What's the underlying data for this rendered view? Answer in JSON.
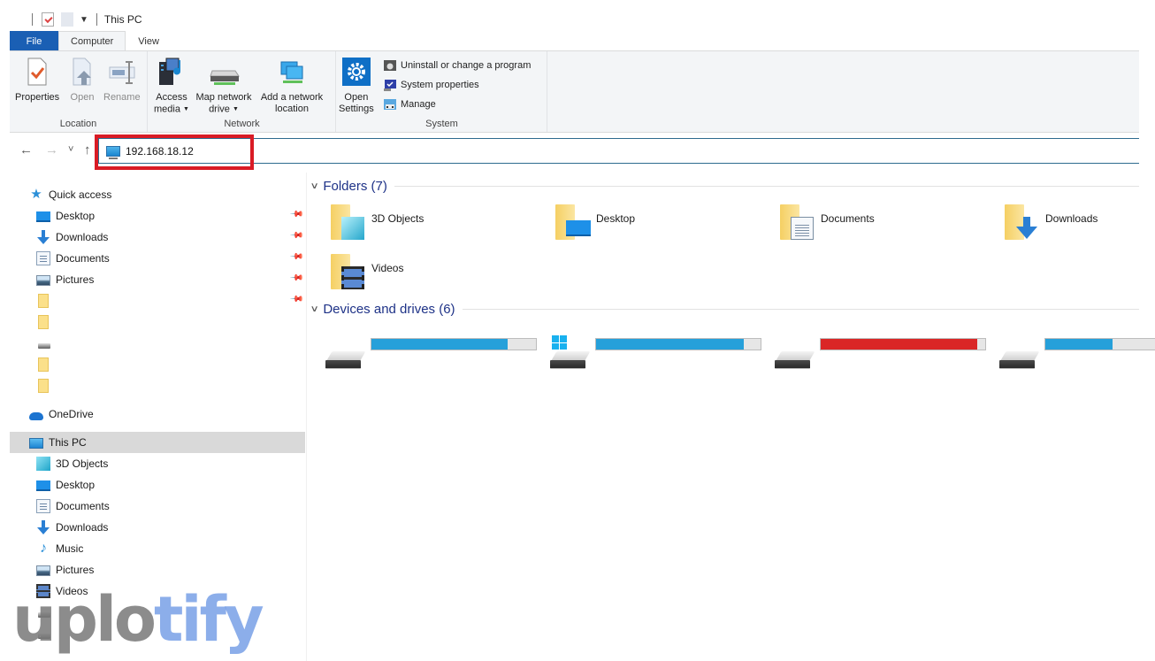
{
  "window": {
    "title": "This PC"
  },
  "quick_access_toolbar": {
    "icons": [
      "properties-icon",
      "new-folder-icon",
      "customize-dropdown-icon"
    ]
  },
  "tabs": [
    {
      "label": "File",
      "active": false
    },
    {
      "label": "Computer",
      "active": true
    },
    {
      "label": "View",
      "active": false
    }
  ],
  "ribbon": {
    "groups": [
      {
        "label": "Location",
        "buttons": [
          {
            "label": "Properties",
            "icon": "properties-icon",
            "enabled": true
          },
          {
            "label": "Open",
            "icon": "open-icon",
            "enabled": false
          },
          {
            "label": "Rename",
            "icon": "rename-icon",
            "enabled": false
          }
        ]
      },
      {
        "label": "Network",
        "buttons": [
          {
            "label_line1": "Access",
            "label_line2": "media",
            "icon": "access-media-icon",
            "dropdown": true
          },
          {
            "label_line1": "Map network",
            "label_line2": "drive",
            "icon": "map-network-drive-icon",
            "dropdown": true
          },
          {
            "label_line1": "Add a network",
            "label_line2": "location",
            "icon": "add-network-location-icon"
          }
        ]
      },
      {
        "label": "System",
        "buttons": [
          {
            "label_line1": "Open",
            "label_line2": "Settings",
            "icon": "settings-gear-icon"
          }
        ],
        "small_buttons": [
          {
            "label": "Uninstall or change a program",
            "icon": "uninstall-program-icon"
          },
          {
            "label": "System properties",
            "icon": "system-properties-icon"
          },
          {
            "label": "Manage",
            "icon": "manage-icon"
          }
        ]
      }
    ]
  },
  "navigation": {
    "back": "←",
    "forward": "→",
    "recent": "˅",
    "up": "↑"
  },
  "address_bar": {
    "value": "192.168.18.12",
    "icon": "this-pc-icon",
    "highlighted": true,
    "highlight_color": "#d91b25"
  },
  "sidebar": {
    "quick_access": {
      "label": "Quick access",
      "items": [
        {
          "label": "Desktop",
          "icon": "desktop-icon",
          "pinned": true
        },
        {
          "label": "Downloads",
          "icon": "downloads-icon",
          "pinned": true
        },
        {
          "label": "Documents",
          "icon": "documents-icon",
          "pinned": true
        },
        {
          "label": "Pictures",
          "icon": "pictures-icon",
          "pinned": true
        },
        {
          "label": "",
          "icon": "folder-icon",
          "pinned": true
        },
        {
          "label": "",
          "icon": "folder-icon",
          "pinned": false
        },
        {
          "label": "",
          "icon": "drive-icon",
          "pinned": false
        },
        {
          "label": "",
          "icon": "folder-icon",
          "pinned": false
        },
        {
          "label": "",
          "icon": "folder-icon",
          "pinned": false
        }
      ]
    },
    "onedrive": {
      "label": "OneDrive"
    },
    "this_pc": {
      "label": "This PC",
      "selected": true,
      "items": [
        {
          "label": "3D Objects",
          "icon": "3d-objects-icon"
        },
        {
          "label": "Desktop",
          "icon": "desktop-icon"
        },
        {
          "label": "Documents",
          "icon": "documents-icon"
        },
        {
          "label": "Downloads",
          "icon": "downloads-icon"
        },
        {
          "label": "Music",
          "icon": "music-icon"
        },
        {
          "label": "Pictures",
          "icon": "pictures-icon"
        },
        {
          "label": "Videos",
          "icon": "videos-icon"
        }
      ]
    },
    "pin_glyph": "📌"
  },
  "content": {
    "folders_section": {
      "label": "Folders (7)",
      "items": [
        {
          "label": "3D Objects"
        },
        {
          "label": "Desktop"
        },
        {
          "label": "Documents"
        },
        {
          "label": "Downloads"
        },
        {
          "label": "Videos"
        }
      ]
    },
    "devices_section": {
      "label": "Devices and drives (6)",
      "drives": [
        {
          "used_fraction": 0.83,
          "bar_color": "#26a0da",
          "windows_drive": false
        },
        {
          "used_fraction": 0.9,
          "bar_color": "#26a0da",
          "windows_drive": true
        },
        {
          "used_fraction": 0.95,
          "bar_color": "#da2626",
          "windows_drive": false
        },
        {
          "used_fraction": 0.41,
          "bar_color": "#26a0da",
          "windows_drive": false
        }
      ]
    }
  },
  "watermark": {
    "part1": "uplo",
    "part2": "tify"
  }
}
